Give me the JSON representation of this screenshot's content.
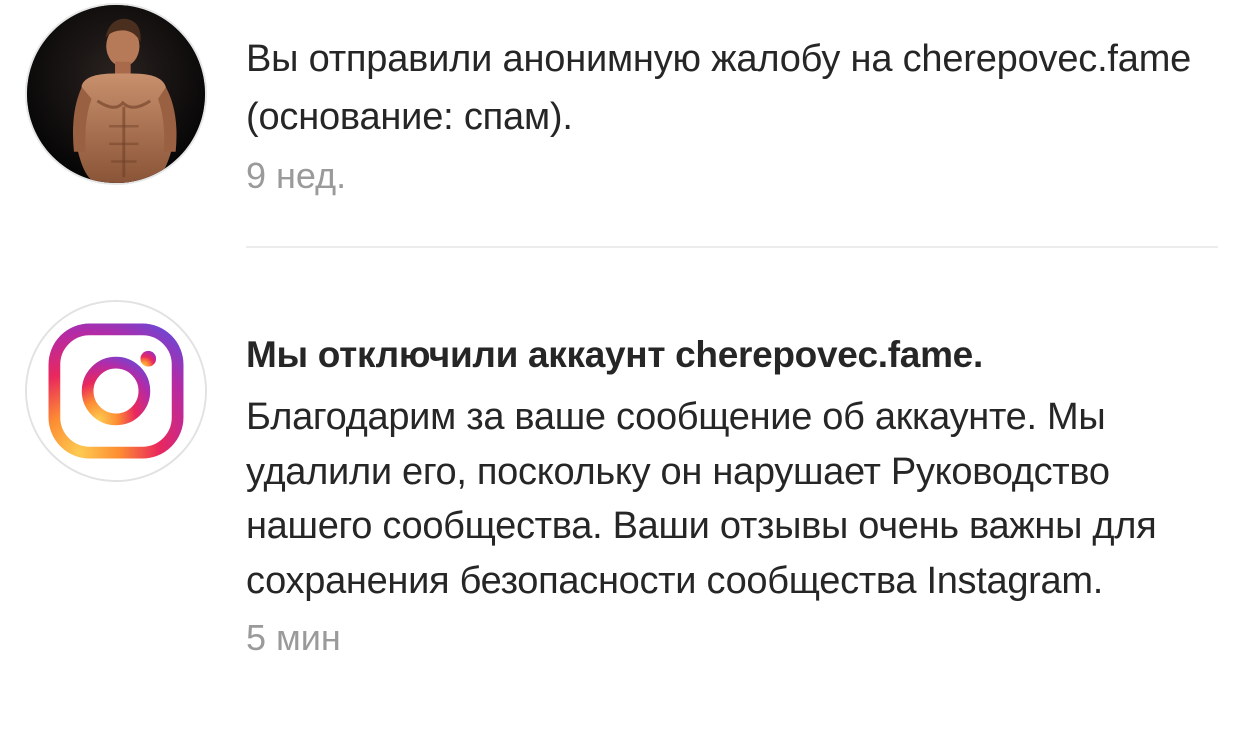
{
  "notifications": [
    {
      "message": "Вы отправили анонимную жалобу на cherepovec.fame (основание: спам).",
      "time": "9 нед."
    },
    {
      "title": "Мы отключили аккаунт cherepovec.fame.",
      "message": "Благодарим за ваше сообщение об аккаунте. Мы удалили его, поскольку он нарушает Руководство нашего сообщества. Ваши отзывы очень важны для сохранения безопасности сообщества Instagram.",
      "time": "5 мин",
      "icon": "instagram-logo-icon"
    }
  ],
  "colors": {
    "text": "#262626",
    "secondary_text": "#9a9a9a",
    "divider": "#ececec"
  }
}
